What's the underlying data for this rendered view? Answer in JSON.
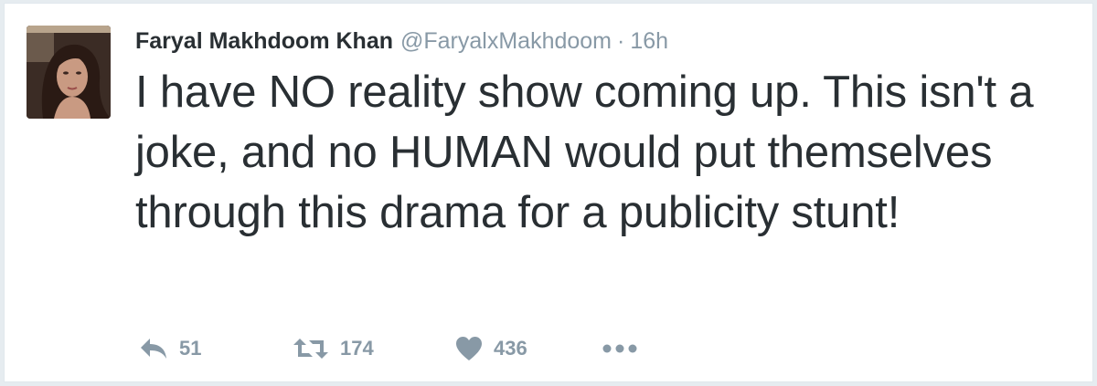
{
  "tweet": {
    "author_name": "Faryal Makhdoom Khan",
    "handle": "@FaryalxMakhdoom",
    "separator": "·",
    "time": "16h",
    "text": "I have NO reality show coming up. This isn't a joke, and no HUMAN would put themselves through this drama for a publicity stunt!"
  },
  "actions": {
    "reply_count": "51",
    "retweet_count": "174",
    "like_count": "436",
    "more_icon": "more-dots-icon"
  },
  "colors": {
    "text": "#292f33",
    "muted": "#8899a6",
    "border": "#e1e8ed"
  }
}
